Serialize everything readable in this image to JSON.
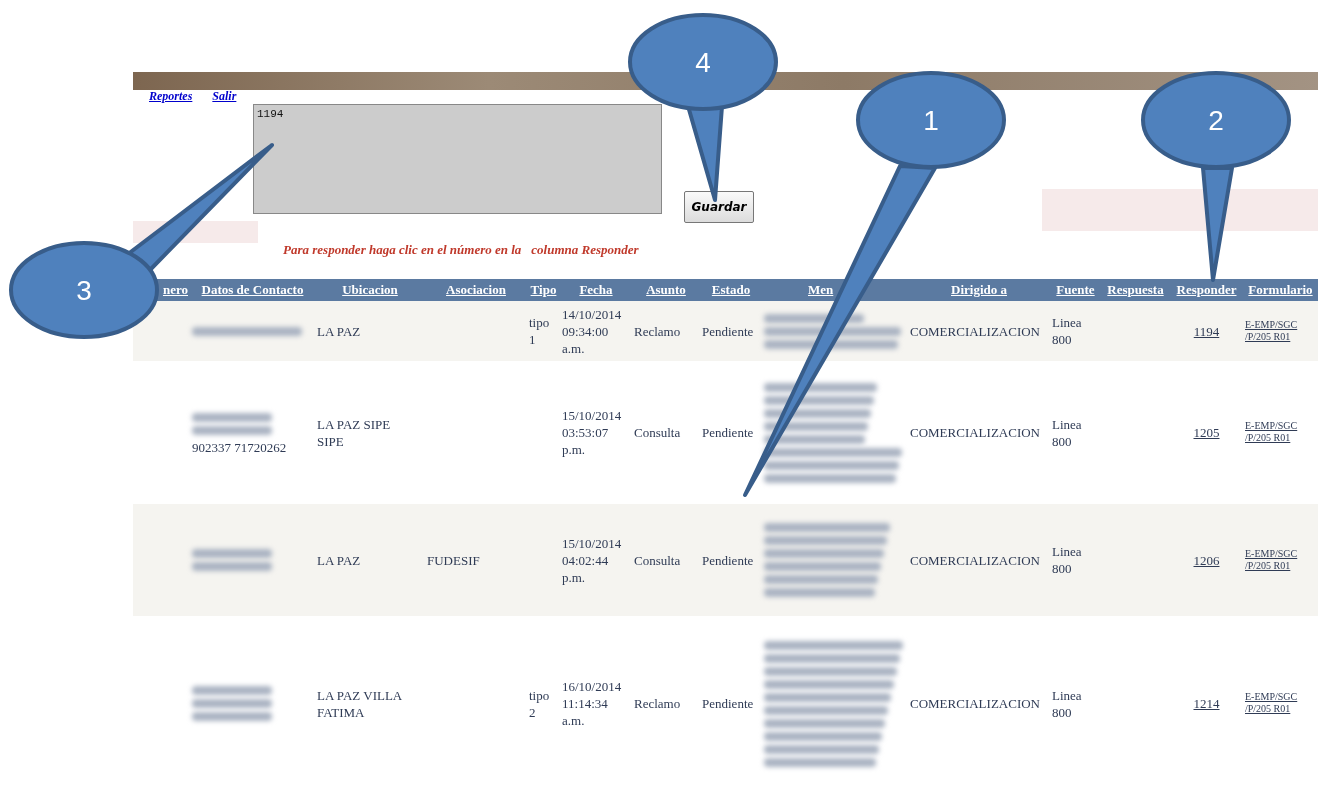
{
  "nav_links": [
    {
      "label": "Reportes"
    },
    {
      "label": "Salir"
    }
  ],
  "response_field": {
    "value": "1194"
  },
  "save_button": {
    "label": "Guardar"
  },
  "instruction": {
    "text": "Para responder haga clic en el número en la",
    "link_text": "columna Responder"
  },
  "table": {
    "columns": [
      "nero",
      "Datos de Contacto",
      "Ubicacion",
      "Asociacion",
      "Tipo",
      "Fecha",
      "Asunto",
      "Estado",
      "Men",
      "Dirigido a",
      "Fuente",
      "Respuesta",
      "Responder",
      "Formulario"
    ],
    "rows": [
      {
        "contact": {
          "redacted": true
        },
        "location": "LA PAZ",
        "association": "",
        "type": "tipo 1",
        "date": "14/10/2014 09:34:00 a.m.",
        "subject": "Reclamo",
        "status": "Pendiente",
        "message": {
          "redacted": true
        },
        "directed_to": "COMERCIALIZACION",
        "source": "Linea 800",
        "reply": "1194",
        "form": "E-EMP/SGC /P/205 R01"
      },
      {
        "contact": {
          "redacted": true,
          "visible_text": "902337 71720262"
        },
        "location": "LA PAZ SIPE SIPE",
        "type": "",
        "date": "15/10/2014 03:53:07 p.m.",
        "subject": "Consulta",
        "status": "Pendiente",
        "message": {
          "redacted": true
        },
        "directed_to": "COMERCIALIZACION",
        "source": "Linea 800",
        "reply": "1205",
        "form": "E-EMP/SGC /P/205 R01"
      },
      {
        "contact": {
          "redacted": true
        },
        "location": "LA PAZ",
        "association": "FUDESIF",
        "date": "15/10/2014 04:02:44 p.m.",
        "subject": "Consulta",
        "status": "Pendiente",
        "message": {
          "redacted": true
        },
        "directed_to": "COMERCIALIZACION",
        "source": "Linea 800",
        "reply": "1206",
        "form": "E-EMP/SGC /P/205 R01"
      },
      {
        "contact": {
          "redacted": true
        },
        "location": "LA PAZ VILLA FATIMA",
        "type": "tipo 2",
        "date": "16/10/2014 11:14:34 a.m.",
        "subject": "Reclamo",
        "status": "Pendiente",
        "message": {
          "redacted": true
        },
        "directed_to": "COMERCIALIZACION",
        "source": "Linea 800",
        "reply": "1214",
        "form": "E-EMP/SGC /P/205 R01"
      }
    ]
  },
  "callouts": [
    {
      "label": "4"
    },
    {
      "label": "1"
    },
    {
      "label": "2"
    },
    {
      "label": "3"
    }
  ]
}
